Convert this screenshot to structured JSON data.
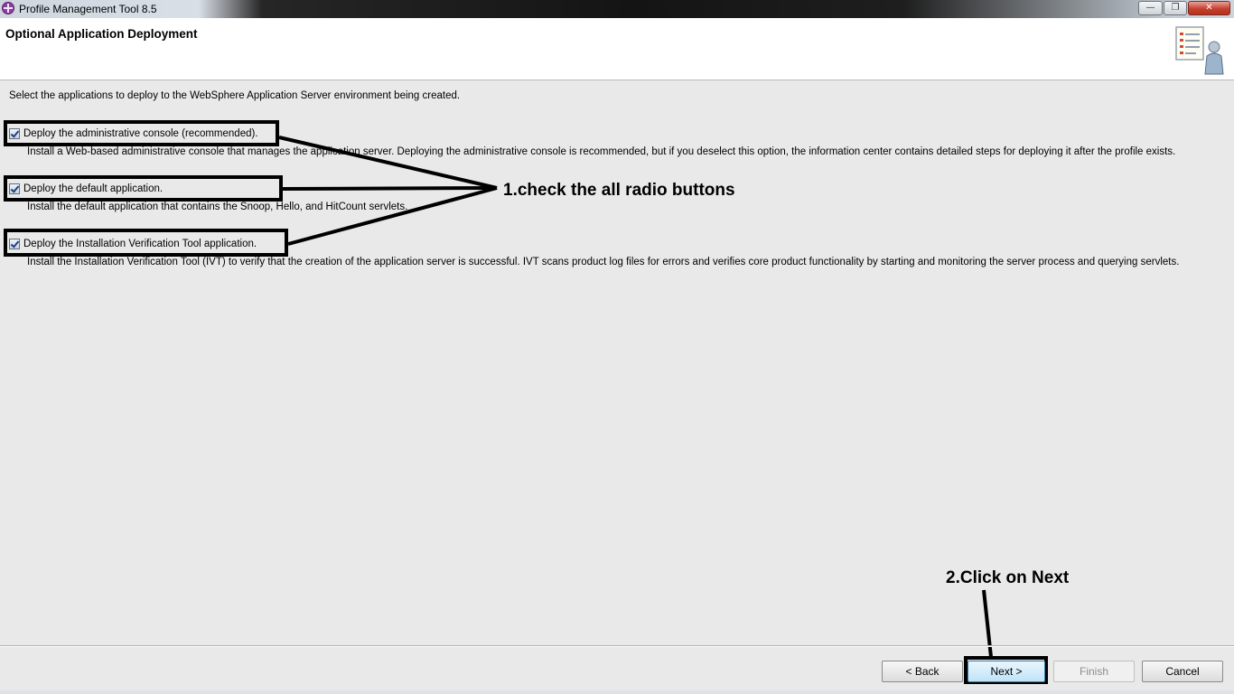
{
  "window": {
    "title": "Profile Management Tool 8.5",
    "minimize_glyph": "—",
    "maximize_glyph": "❐",
    "close_glyph": "✕"
  },
  "header": {
    "title": "Optional Application Deployment",
    "icon": "wizard-banner-icon"
  },
  "content": {
    "intro": "Select the applications to deploy to the WebSphere Application Server environment being created.",
    "options": [
      {
        "label": "Deploy the administrative console (recommended).",
        "checked": true,
        "description": "Install a Web-based administrative console that manages the application server. Deploying the administrative console is recommended, but if you deselect this option, the information center contains detailed steps for deploying it after the profile exists."
      },
      {
        "label": "Deploy the default application.",
        "checked": true,
        "description": "Install the default application that contains the Snoop, Hello, and HitCount servlets."
      },
      {
        "label": "Deploy the Installation Verification Tool application.",
        "checked": true,
        "description": "Install the Installation Verification Tool (IVT) to verify that the creation of the application server is successful. IVT scans product log files for errors and verifies core product functionality by starting and monitoring the server process and querying servlets."
      }
    ]
  },
  "annotations": {
    "step1": "1.check the all radio buttons",
    "step2": "2.Click on Next"
  },
  "footer": {
    "back_label": "< Back",
    "next_label": "Next >",
    "finish_label": "Finish",
    "cancel_label": "Cancel"
  }
}
